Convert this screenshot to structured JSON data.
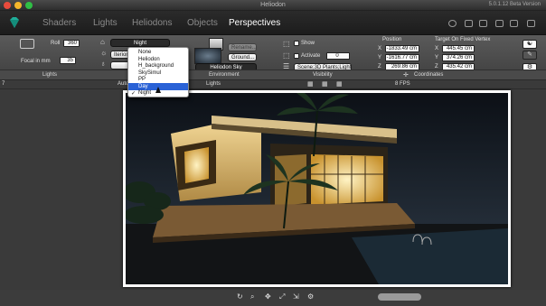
{
  "window": {
    "title": "Heliodon",
    "version": "5.0.1.12 Beta Version",
    "colors": {
      "close": "#e94b3c",
      "minimize": "#f5b62b",
      "zoom": "#2fbf45",
      "accent": "#2a62d6"
    }
  },
  "nav": {
    "tabs": [
      "Shaders",
      "Lights",
      "Heliodons",
      "Objects",
      "Perspectives"
    ],
    "active": "Perspectives",
    "icons": [
      "clock-icon",
      "phone-icon",
      "chat-icon",
      "camera-icon",
      "crop-icon",
      "window-icon"
    ]
  },
  "camera": {
    "roll_label": "Roll",
    "roll_value": "360",
    "focal_label": "Focal in mm",
    "focal_value": "35"
  },
  "lights": {
    "mode_value": "Night",
    "options": [
      "None",
      "Heliodon",
      "H_background",
      "SkySimul",
      "PP",
      "Day",
      "Night"
    ],
    "selected": "Day",
    "checked": "Night",
    "ghost_1": "Iterior",
    "ghost_2": "",
    "btn1": "+ Ba"
  },
  "environment": {
    "ground_label": "Ground...",
    "sky_value": "Heliodon Sky",
    "ghost_top": "Rename..."
  },
  "visibility": {
    "show_label": "Show",
    "activate_label": "Activate",
    "activate_value": "0",
    "scene_value": "Scene;3D Plants;Light"
  },
  "position": {
    "title": "Position",
    "x": "-1833.49 cm",
    "y": "-1616.77 cm",
    "z": "269.86 cm"
  },
  "target": {
    "title": "Target On Fixed Vertex",
    "x": "445.45 cm",
    "y": "374.26 cm",
    "z": "435.42 cm"
  },
  "sections": {
    "lights": "Lights",
    "environment": "Environment",
    "visibility": "Visibility",
    "coordinates": "Coordinates"
  },
  "subbar": {
    "left": "Auto",
    "lights": "Lights",
    "fps": "8 FPS",
    "number": "7"
  },
  "viewport": {
    "alt": "render"
  },
  "bottom": {
    "icons": [
      "rotate-icon",
      "zoom-icon",
      "pan-icon",
      "fit-icon",
      "resize-icon",
      "settings-icon"
    ]
  }
}
